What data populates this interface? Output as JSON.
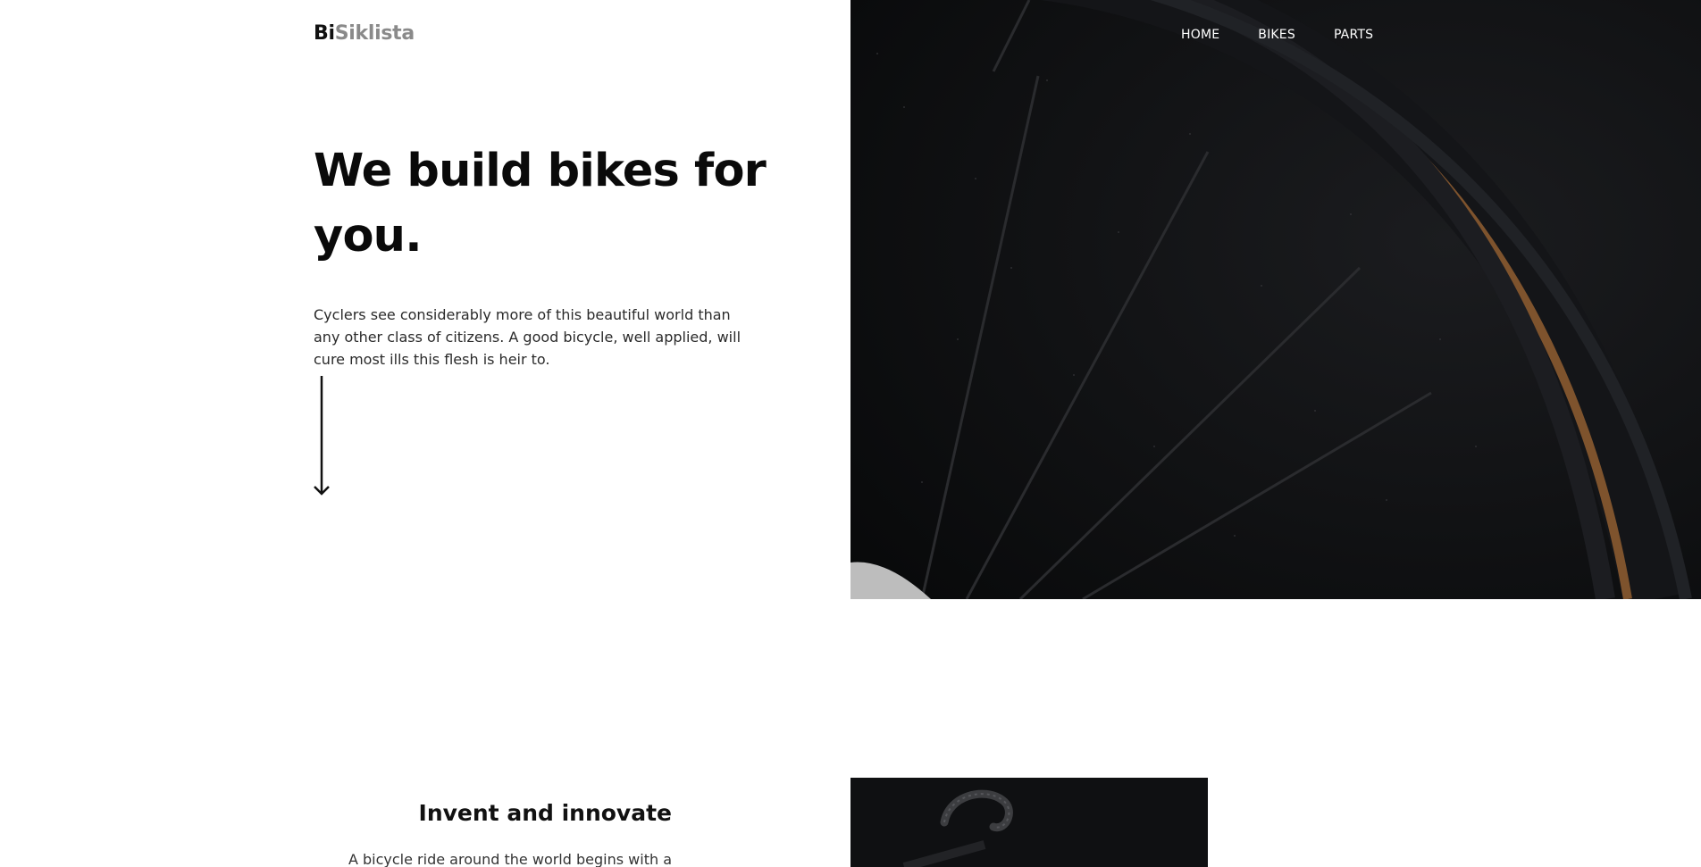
{
  "brand": {
    "part1": "Bi",
    "part2": "Siklista"
  },
  "nav": {
    "items": [
      {
        "label": "HOME"
      },
      {
        "label": "BIKES"
      },
      {
        "label": "PARTS"
      }
    ]
  },
  "hero": {
    "headline": "We build bikes for you.",
    "lead": "Cyclers see considerably more of this beautiful world than any other class of citizens. A good bicycle, well applied, will cure most ills this flesh is heir to."
  },
  "feature": {
    "title": "Invent and innovate",
    "text": "A bicycle ride around the world begins with a"
  },
  "colors": {
    "text": "#0a0a0a",
    "brand_muted": "#8a8a8a",
    "hero_bg": "#0d0e10",
    "tire_tan": "#8a5a30"
  }
}
